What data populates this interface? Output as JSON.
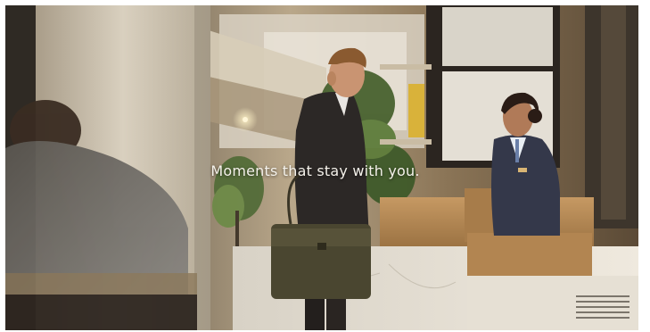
{
  "video": {
    "caption": "Moments that stay with you."
  },
  "colors": {
    "wall_warm": "#c9b08a",
    "pillar": "#cfc5b4",
    "desk_marble": "#e8e2d6",
    "desk_wood": "#b98a55",
    "suit_dark": "#2a2624",
    "uniform_navy": "#34384a",
    "bag_olive": "#4a4630"
  }
}
